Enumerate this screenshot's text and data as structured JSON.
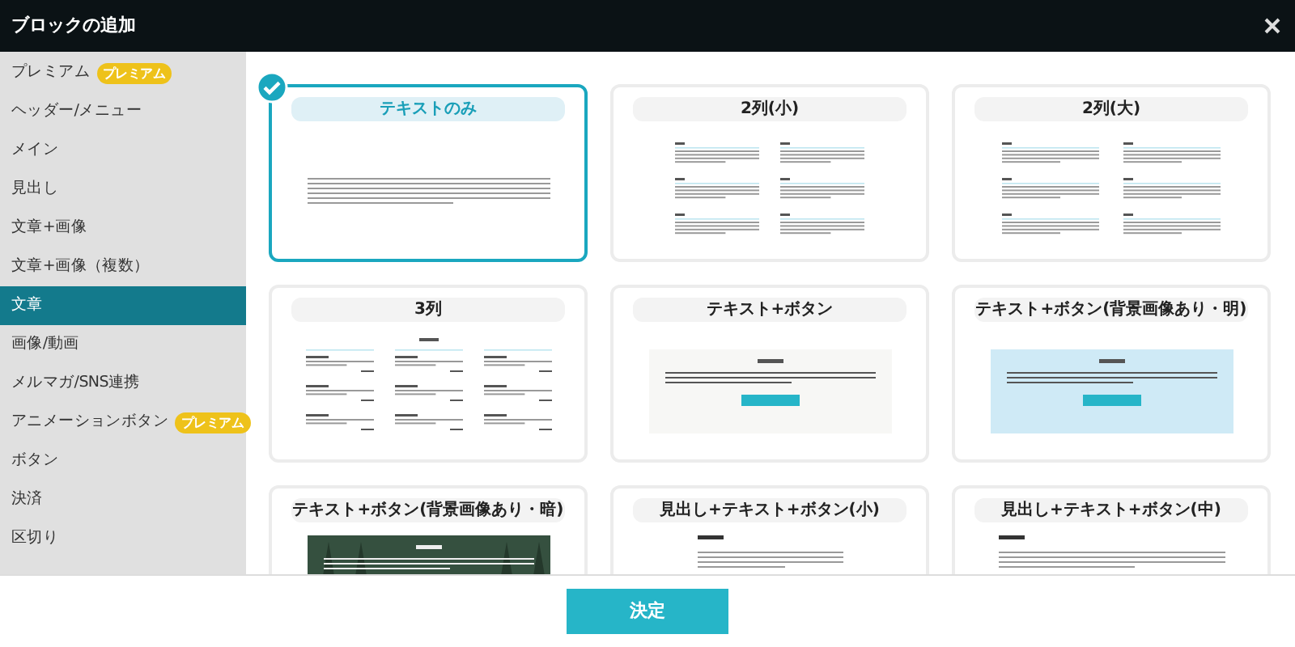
{
  "window": {
    "title": "ブロックの追加"
  },
  "sidebar": {
    "items": [
      {
        "label": "プレミアム",
        "badge": "プレミアム",
        "selected": false
      },
      {
        "label": "ヘッダー/メニュー",
        "selected": false
      },
      {
        "label": "メイン",
        "selected": false
      },
      {
        "label": "見出し",
        "selected": false
      },
      {
        "label": "文章+画像",
        "selected": false
      },
      {
        "label": "文章+画像（複数）",
        "selected": false
      },
      {
        "label": "文章",
        "selected": true
      },
      {
        "label": "画像/動画",
        "selected": false
      },
      {
        "label": "メルマガ/SNS連携",
        "selected": false
      },
      {
        "label": "アニメーションボタン",
        "badge": "プレミアム",
        "selected": false
      },
      {
        "label": "ボタン",
        "selected": false
      },
      {
        "label": "決済",
        "selected": false
      },
      {
        "label": "区切り",
        "selected": false
      }
    ]
  },
  "blocks": [
    {
      "title": "テキストのみ",
      "kind": "text",
      "selected": true
    },
    {
      "title": "2列(小)",
      "kind": "cols2small",
      "selected": false
    },
    {
      "title": "2列(大)",
      "kind": "cols2large",
      "selected": false
    },
    {
      "title": "3列",
      "kind": "cols3",
      "selected": false
    },
    {
      "title": "テキスト+ボタン",
      "kind": "textbutton",
      "selected": false
    },
    {
      "title": "テキスト+ボタン(背景画像あり・明)",
      "kind": "bglight",
      "selected": false
    },
    {
      "title": "テキスト+ボタン(背景画像あり・暗)",
      "kind": "bgdark",
      "selected": false
    },
    {
      "title": "見出し+テキスト+ボタン(小)",
      "kind": "headsmall",
      "selected": false
    },
    {
      "title": "見出し+テキスト+ボタン(中)",
      "kind": "headmid",
      "selected": false
    }
  ],
  "footer": {
    "button": "決定"
  }
}
